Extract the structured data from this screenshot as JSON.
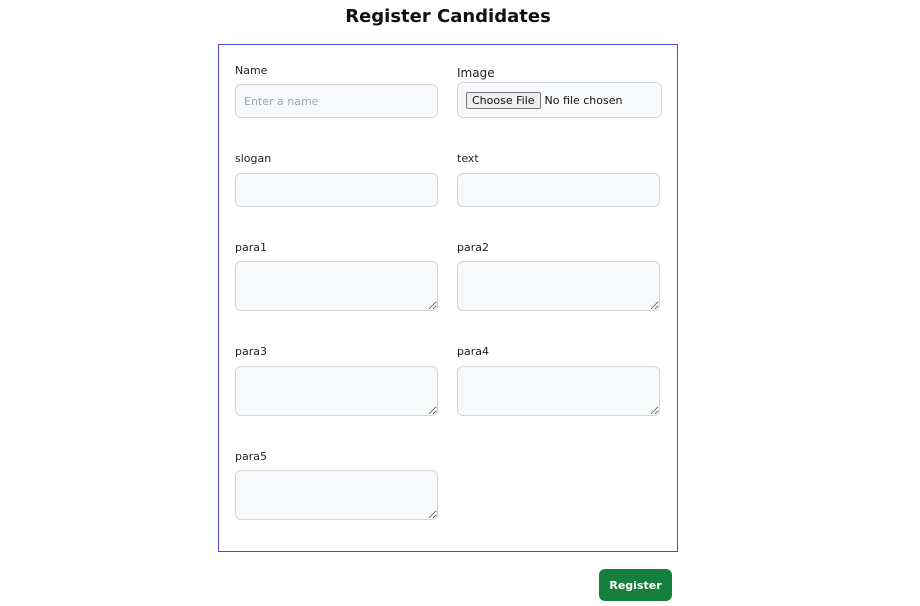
{
  "title": "Register Candidates",
  "fields": {
    "name": {
      "label": "Name",
      "placeholder": "Enter a name"
    },
    "image": {
      "label": "Image",
      "button": "Choose File",
      "status": "No file chosen"
    },
    "slogan": {
      "label": "slogan"
    },
    "text": {
      "label": "text"
    },
    "para1": {
      "label": "para1"
    },
    "para2": {
      "label": "para2"
    },
    "para3": {
      "label": "para3"
    },
    "para4": {
      "label": "para4"
    },
    "para5": {
      "label": "para5"
    }
  },
  "submit": "Register",
  "colors": {
    "border": "#4f46e5",
    "button": "#15803d"
  }
}
